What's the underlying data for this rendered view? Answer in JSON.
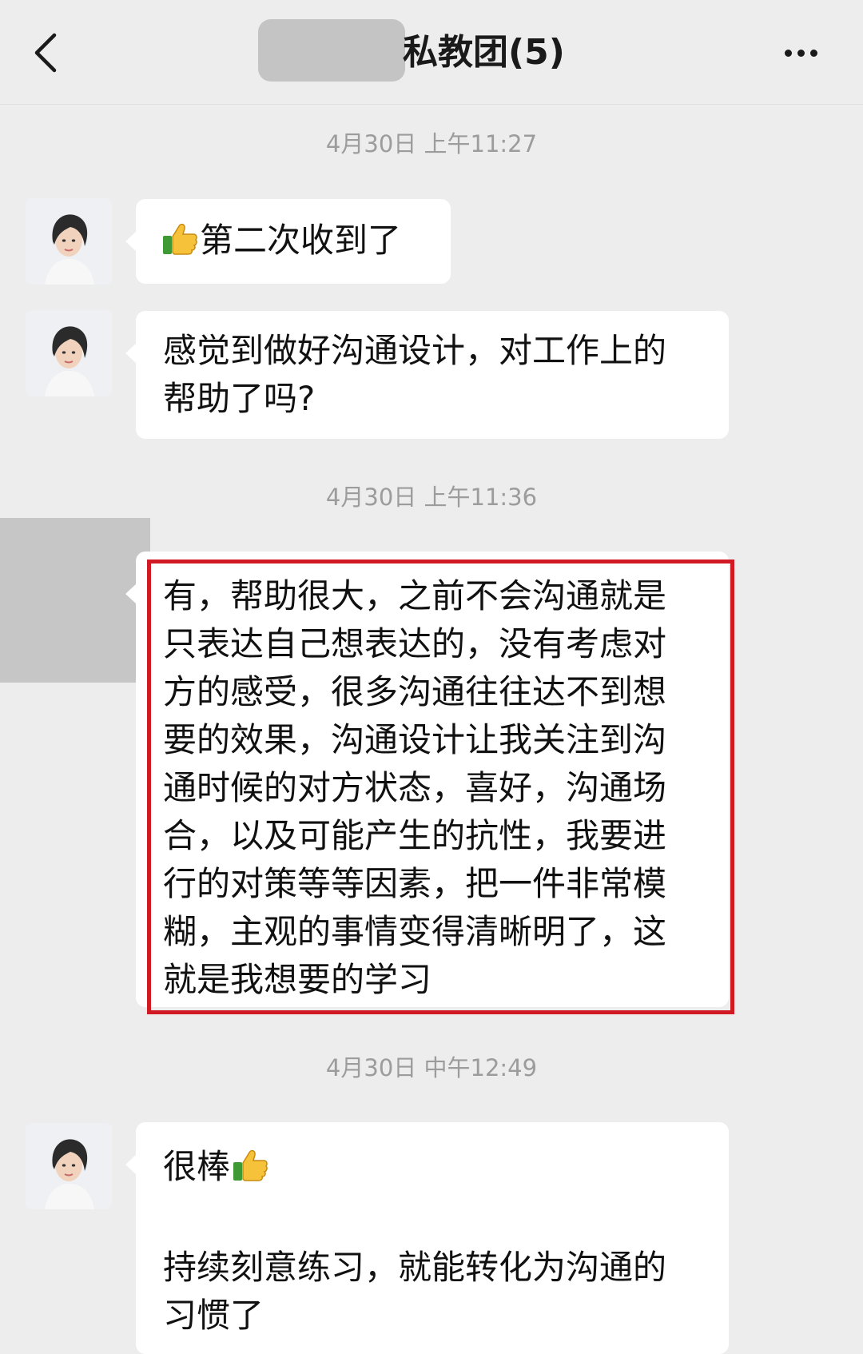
{
  "header": {
    "title": "私教团(5)"
  },
  "messages": [
    {
      "timestamp": "4月30日 上午11:27"
    },
    {
      "text": "第二次收到了"
    },
    {
      "text": "感觉到做好沟通设计，对工作上的\n帮助了吗?"
    },
    {
      "timestamp": "4月30日 上午11:36"
    },
    {
      "text": "有，帮助很大，之前不会沟通就是\n只表达自己想表达的，没有考虑对\n方的感受，很多沟通往往达不到想\n要的效果，沟通设计让我关注到沟\n通时候的对方状态，喜好，沟通场\n合，以及可能产生的抗性，我要进\n行的对策等等因素，把一件非常模\n糊，主观的事情变得清晰明了，这\n就是我想要的学习"
    },
    {
      "timestamp": "4月30日 中午12:49"
    },
    {
      "text": "很棒",
      "text2": "持续刻意练习，就能转化为沟通的\n习惯了"
    }
  ],
  "colors": {
    "background": "#ededed",
    "bubble": "#ffffff",
    "highlight_border": "#d21a24",
    "timestamp": "#9c9c9c"
  },
  "icons": [
    "back-arrow-icon",
    "more-options-icon",
    "thumbs-up-icon"
  ]
}
